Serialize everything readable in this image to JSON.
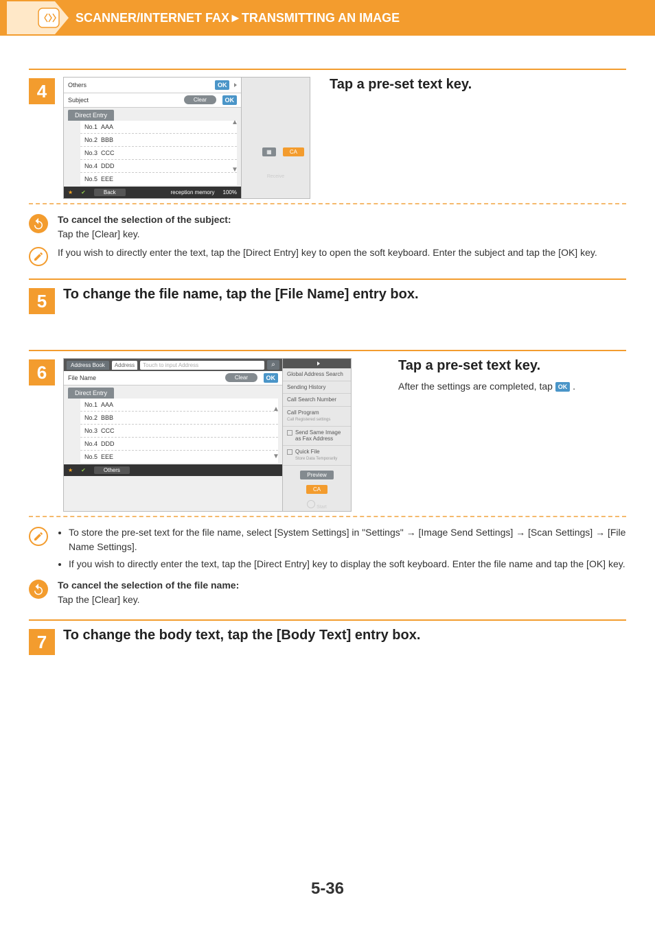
{
  "banner": {
    "title": "SCANNER/INTERNET FAX►TRANSMITTING AN IMAGE"
  },
  "steps": {
    "s4": {
      "num": "4",
      "title": "Tap a pre-set text key.",
      "screenshot": {
        "top_label": "Others",
        "ok": "OK",
        "subject_label": "Subject",
        "clear": "Clear",
        "direct_entry": "Direct Entry",
        "rows": [
          {
            "no": "No.1",
            "val": "AAA"
          },
          {
            "no": "No.2",
            "val": "BBB"
          },
          {
            "no": "No.3",
            "val": "CCC"
          },
          {
            "no": "No.4",
            "val": "DDD"
          },
          {
            "no": "No.5",
            "val": "EEE"
          }
        ],
        "back": "Back",
        "mem_label": "reception memory",
        "mem_val": "100%",
        "ca": "CA",
        "receive": "Receive"
      },
      "cancel_title": "To cancel the selection of the subject:",
      "cancel_body": "Tap the [Clear] key.",
      "direct_note": "If you wish to directly enter the text, tap the [Direct Entry] key to open the soft keyboard. Enter the subject and tap the [OK] key."
    },
    "s5": {
      "num": "5",
      "title": "To change the file name, tap the [File Name] entry box."
    },
    "s6": {
      "num": "6",
      "title": "Tap a pre-set text key.",
      "desc_pre": "After the settings are completed, tap ",
      "desc_post": " .",
      "screenshot": {
        "addr_book": "Address Book",
        "addr_tab": "Address",
        "addr_placeholder": "Touch to input Address",
        "ok": "OK",
        "file_name": "File Name",
        "clear": "Clear",
        "direct_entry": "Direct Entry",
        "rows": [
          {
            "no": "No.1",
            "val": "AAA"
          },
          {
            "no": "No.2",
            "val": "BBB"
          },
          {
            "no": "No.3",
            "val": "CCC"
          },
          {
            "no": "No.4",
            "val": "DDD"
          },
          {
            "no": "No.5",
            "val": "EEE"
          }
        ],
        "others": "Others",
        "side": {
          "g_search": "Global Address Search",
          "history": "Sending History",
          "call_num": "Call Search Number",
          "call_prog": "Call Program",
          "call_prog_sub": "Call Registered settings",
          "same_img": "Send Same Image as Fax Address",
          "quick": "Quick File",
          "quick_sub": "Store Data Temporarily",
          "preview": "Preview",
          "ca": "CA",
          "start": "Start"
        }
      },
      "bullets": [
        "To store the pre-set text for the file name, select [System Settings] in \"Settings\" → [Image Send Settings] → [Scan Settings] → [File Name Settings].",
        "If you wish to directly enter the text, tap the [Direct Entry] key to display the soft keyboard. Enter the file name and tap the [OK] key."
      ],
      "cancel_title": "To cancel the selection of the file name:",
      "cancel_body": "Tap the [Clear] key."
    },
    "s7": {
      "num": "7",
      "title": "To change the body text, tap the [Body Text] entry box."
    }
  },
  "ok_badge": "OK",
  "page_num": "5-36"
}
